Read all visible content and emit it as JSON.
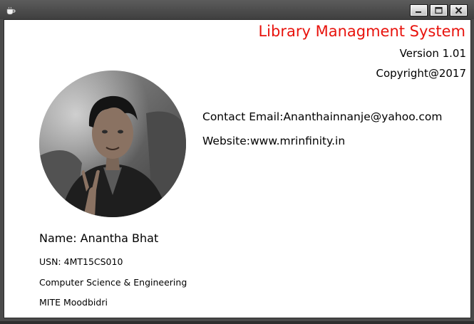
{
  "window": {
    "app_icon": "coffee-cup-icon",
    "controls": {
      "minimize_icon": "minimize-icon",
      "maximize_icon": "maximize-icon",
      "close_icon": "close-icon"
    }
  },
  "header": {
    "title": "Library Managment System",
    "version": "Version 1.01",
    "copyright": "Copyright@2017"
  },
  "contact": {
    "email": "Contact Email:Ananthainnanje@yahoo.com",
    "website": "Website:www.mrinfinity.in"
  },
  "profile": {
    "photo": "profile-photo",
    "name": "Name: Anantha Bhat",
    "usn": "USN: 4MT15CS010",
    "department": "Computer Science & Engineering",
    "college": "MITE Moodbidri"
  },
  "colors": {
    "title": "#e8130d",
    "window_frame": "#4a4a4a",
    "client_background": "#ffffff"
  }
}
